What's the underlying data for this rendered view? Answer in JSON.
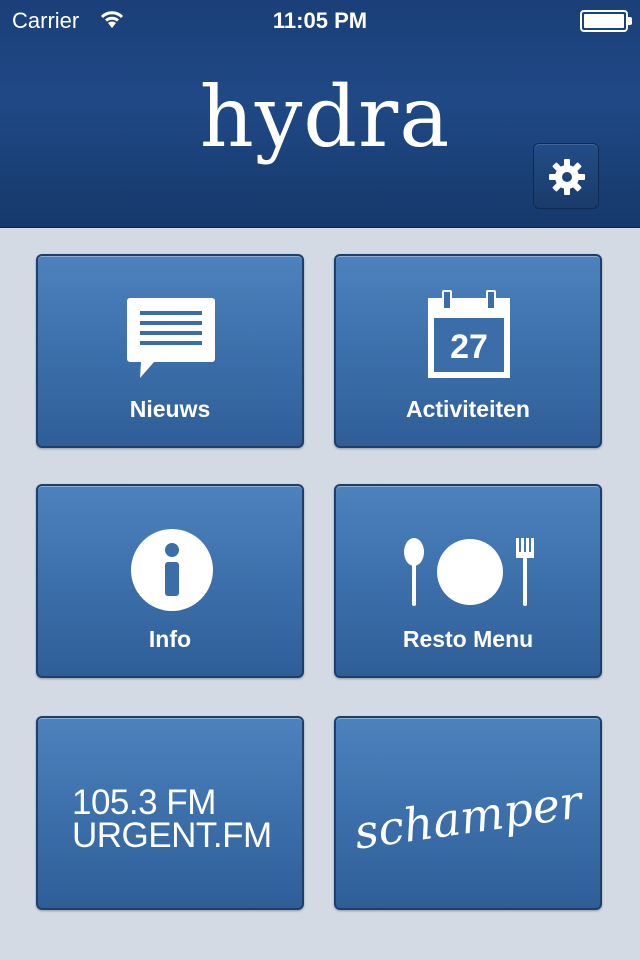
{
  "status_bar": {
    "carrier": "Carrier",
    "time": "11:05 PM",
    "wifi_icon": "wifi-icon",
    "battery_icon": "battery-icon",
    "battery_level": 1.0
  },
  "header": {
    "logo_text": "hydra",
    "settings_icon": "gear-icon"
  },
  "tiles": [
    {
      "label": "Nieuws",
      "icon": "news-message-icon"
    },
    {
      "label": "Activiteiten",
      "icon": "calendar-icon",
      "calendar_day": "27"
    },
    {
      "label": "Info",
      "icon": "info-icon"
    },
    {
      "label": "Resto Menu",
      "icon": "plate-cutlery-icon"
    },
    {
      "label": "",
      "icon": "urgent-fm-logo",
      "line1": "105.3 FM",
      "line2": "URGENT.FM"
    },
    {
      "label": "",
      "icon": "schamper-logo",
      "text": "schamper"
    }
  ],
  "colors": {
    "header_bg": "#1f4985",
    "tile_bg": "#3b6ea9",
    "page_bg": "#d3dae3",
    "text": "#ffffff"
  }
}
